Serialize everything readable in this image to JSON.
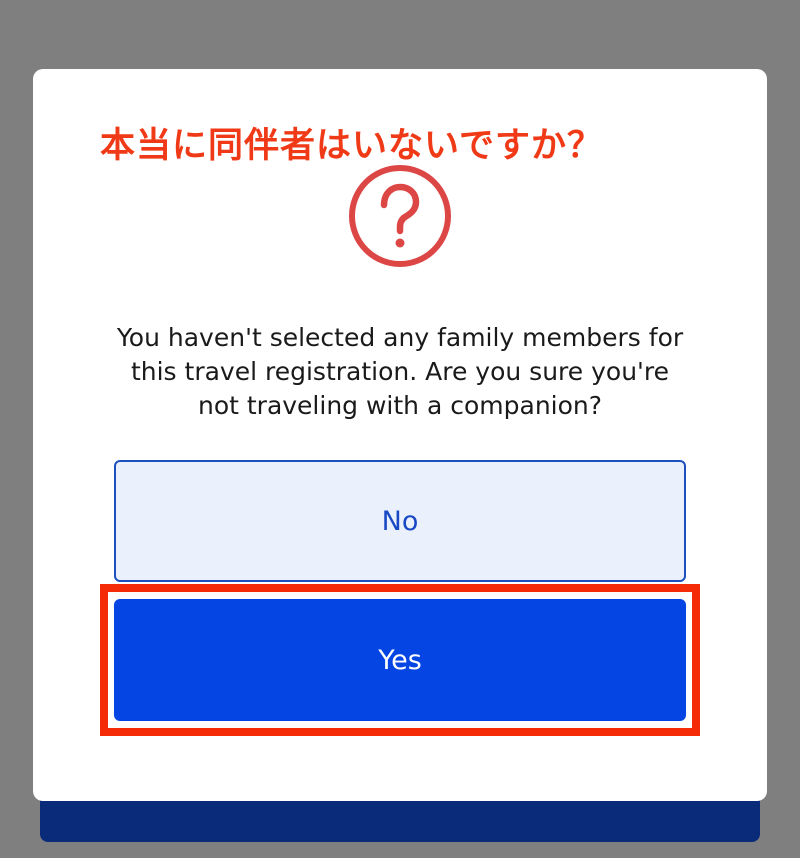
{
  "annotation": {
    "title": "本当に同伴者はいないですか？",
    "highlight_color": "#f52b07"
  },
  "dialog": {
    "icon": "question-circle-icon",
    "icon_color": "#dc4746",
    "message": "You haven't selected any family members for this travel registration. Are you sure you're not traveling with a companion?",
    "no_label": "No",
    "yes_label": "Yes"
  },
  "colors": {
    "primary_blue": "#0445e3",
    "secondary_bg": "#ebf1fc",
    "overlay": "#7f7f7f",
    "navy": "#0a2a7a"
  }
}
